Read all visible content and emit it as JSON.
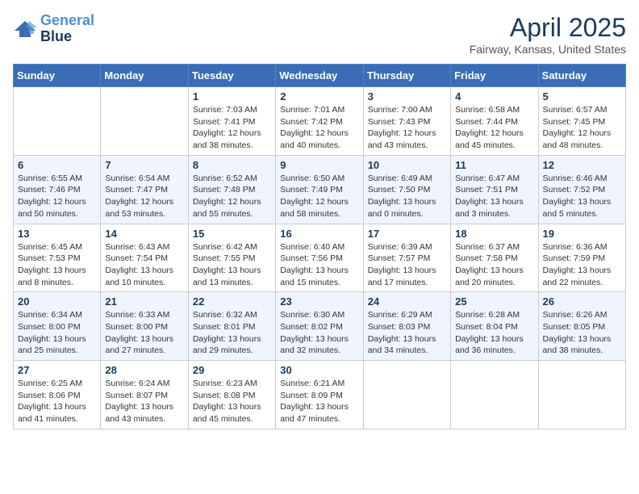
{
  "header": {
    "logo_line1": "General",
    "logo_line2": "Blue",
    "month_title": "April 2025",
    "location": "Fairway, Kansas, United States"
  },
  "days_of_week": [
    "Sunday",
    "Monday",
    "Tuesday",
    "Wednesday",
    "Thursday",
    "Friday",
    "Saturday"
  ],
  "weeks": [
    [
      {
        "num": "",
        "info": ""
      },
      {
        "num": "",
        "info": ""
      },
      {
        "num": "1",
        "info": "Sunrise: 7:03 AM\nSunset: 7:41 PM\nDaylight: 12 hours and 38 minutes."
      },
      {
        "num": "2",
        "info": "Sunrise: 7:01 AM\nSunset: 7:42 PM\nDaylight: 12 hours and 40 minutes."
      },
      {
        "num": "3",
        "info": "Sunrise: 7:00 AM\nSunset: 7:43 PM\nDaylight: 12 hours and 43 minutes."
      },
      {
        "num": "4",
        "info": "Sunrise: 6:58 AM\nSunset: 7:44 PM\nDaylight: 12 hours and 45 minutes."
      },
      {
        "num": "5",
        "info": "Sunrise: 6:57 AM\nSunset: 7:45 PM\nDaylight: 12 hours and 48 minutes."
      }
    ],
    [
      {
        "num": "6",
        "info": "Sunrise: 6:55 AM\nSunset: 7:46 PM\nDaylight: 12 hours and 50 minutes."
      },
      {
        "num": "7",
        "info": "Sunrise: 6:54 AM\nSunset: 7:47 PM\nDaylight: 12 hours and 53 minutes."
      },
      {
        "num": "8",
        "info": "Sunrise: 6:52 AM\nSunset: 7:48 PM\nDaylight: 12 hours and 55 minutes."
      },
      {
        "num": "9",
        "info": "Sunrise: 6:50 AM\nSunset: 7:49 PM\nDaylight: 12 hours and 58 minutes."
      },
      {
        "num": "10",
        "info": "Sunrise: 6:49 AM\nSunset: 7:50 PM\nDaylight: 13 hours and 0 minutes."
      },
      {
        "num": "11",
        "info": "Sunrise: 6:47 AM\nSunset: 7:51 PM\nDaylight: 13 hours and 3 minutes."
      },
      {
        "num": "12",
        "info": "Sunrise: 6:46 AM\nSunset: 7:52 PM\nDaylight: 13 hours and 5 minutes."
      }
    ],
    [
      {
        "num": "13",
        "info": "Sunrise: 6:45 AM\nSunset: 7:53 PM\nDaylight: 13 hours and 8 minutes."
      },
      {
        "num": "14",
        "info": "Sunrise: 6:43 AM\nSunset: 7:54 PM\nDaylight: 13 hours and 10 minutes."
      },
      {
        "num": "15",
        "info": "Sunrise: 6:42 AM\nSunset: 7:55 PM\nDaylight: 13 hours and 13 minutes."
      },
      {
        "num": "16",
        "info": "Sunrise: 6:40 AM\nSunset: 7:56 PM\nDaylight: 13 hours and 15 minutes."
      },
      {
        "num": "17",
        "info": "Sunrise: 6:39 AM\nSunset: 7:57 PM\nDaylight: 13 hours and 17 minutes."
      },
      {
        "num": "18",
        "info": "Sunrise: 6:37 AM\nSunset: 7:58 PM\nDaylight: 13 hours and 20 minutes."
      },
      {
        "num": "19",
        "info": "Sunrise: 6:36 AM\nSunset: 7:59 PM\nDaylight: 13 hours and 22 minutes."
      }
    ],
    [
      {
        "num": "20",
        "info": "Sunrise: 6:34 AM\nSunset: 8:00 PM\nDaylight: 13 hours and 25 minutes."
      },
      {
        "num": "21",
        "info": "Sunrise: 6:33 AM\nSunset: 8:00 PM\nDaylight: 13 hours and 27 minutes."
      },
      {
        "num": "22",
        "info": "Sunrise: 6:32 AM\nSunset: 8:01 PM\nDaylight: 13 hours and 29 minutes."
      },
      {
        "num": "23",
        "info": "Sunrise: 6:30 AM\nSunset: 8:02 PM\nDaylight: 13 hours and 32 minutes."
      },
      {
        "num": "24",
        "info": "Sunrise: 6:29 AM\nSunset: 8:03 PM\nDaylight: 13 hours and 34 minutes."
      },
      {
        "num": "25",
        "info": "Sunrise: 6:28 AM\nSunset: 8:04 PM\nDaylight: 13 hours and 36 minutes."
      },
      {
        "num": "26",
        "info": "Sunrise: 6:26 AM\nSunset: 8:05 PM\nDaylight: 13 hours and 38 minutes."
      }
    ],
    [
      {
        "num": "27",
        "info": "Sunrise: 6:25 AM\nSunset: 8:06 PM\nDaylight: 13 hours and 41 minutes."
      },
      {
        "num": "28",
        "info": "Sunrise: 6:24 AM\nSunset: 8:07 PM\nDaylight: 13 hours and 43 minutes."
      },
      {
        "num": "29",
        "info": "Sunrise: 6:23 AM\nSunset: 8:08 PM\nDaylight: 13 hours and 45 minutes."
      },
      {
        "num": "30",
        "info": "Sunrise: 6:21 AM\nSunset: 8:09 PM\nDaylight: 13 hours and 47 minutes."
      },
      {
        "num": "",
        "info": ""
      },
      {
        "num": "",
        "info": ""
      },
      {
        "num": "",
        "info": ""
      }
    ]
  ]
}
